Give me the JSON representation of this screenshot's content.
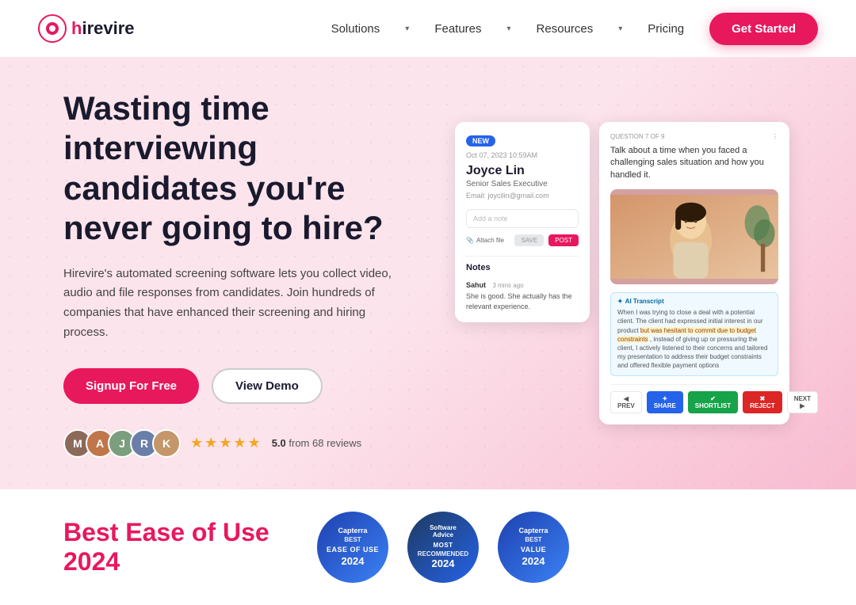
{
  "nav": {
    "logo_text": "hirevire",
    "links": [
      {
        "label": "Solutions",
        "has_dropdown": true
      },
      {
        "label": "Features",
        "has_dropdown": true
      },
      {
        "label": "Resources",
        "has_dropdown": true
      },
      {
        "label": "Pricing",
        "has_dropdown": false
      }
    ],
    "cta_label": "Get Started"
  },
  "hero": {
    "title": "Wasting time interviewing candidates you're never going to hire?",
    "subtitle": "Hirevire's automated screening software lets you collect video, audio and file responses from candidates. Join hundreds of companies that have enhanced their screening and hiring process.",
    "btn_signup": "Signup For Free",
    "btn_demo": "View Demo",
    "reviews": {
      "score": "5.0",
      "count": "from 68 reviews"
    }
  },
  "mockup": {
    "card_left": {
      "badge": "NEW",
      "date": "Oct 07, 2023 10:59AM",
      "name": "Joyce Lin",
      "role": "Senior Sales Executive",
      "email_label": "Email",
      "email": "joycilin@gmail.com",
      "note_placeholder": "Add a note",
      "attach_label": "Attach file",
      "save_label": "SAVE",
      "post_label": "POST",
      "notes_title": "Notes",
      "note_author": "Sahut",
      "note_time": "3 mins ago",
      "note_text": "She is good. She actually has the relevant experience."
    },
    "card_right": {
      "question_meta": "QUESTION 7 OF 9",
      "question_text": "Talk about a time when you faced a challenging sales situation and how you handled it.",
      "ai_label": "AI Transcript",
      "ai_text": "When I was trying to close a deal with a potential client. The client had expressed initial interest in our product",
      "ai_highlight": "but was hesitant to commit due to budget constraints",
      "ai_text2": ", instead of giving up or pressuring the client, I actively listened to their concerns and tailored my presentation to address their budget constraints and offered flexible payment options",
      "btn_prev": "◀ PREV",
      "btn_share": "✦ SHARE",
      "btn_shortlist": "✔ SHORTLIST",
      "btn_reject": "✖ REJECT",
      "btn_next": "NEXT ▶"
    }
  },
  "bottom": {
    "title": "Best Ease of Use 2024",
    "badges": [
      {
        "logo": "Capterra",
        "main": "BEST EASE OF USE",
        "year": "2024"
      },
      {
        "logo": "Software Advice",
        "main": "MOST RECOMMENDED",
        "year": "2024"
      },
      {
        "logo": "Capterra",
        "main": "BEST VALUE",
        "year": "2024"
      }
    ]
  }
}
